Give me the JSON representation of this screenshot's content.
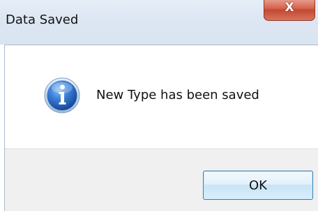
{
  "window": {
    "title": "Data Saved",
    "close_glyph": "X"
  },
  "message": {
    "icon": "information-icon",
    "text": "New Type has been saved"
  },
  "buttons": {
    "ok_label": "OK"
  },
  "colors": {
    "titlebar": "#dde7f3",
    "close_button": "#d7654f",
    "button_area": "#f0f0f0",
    "ok_border": "#3c7fb1",
    "icon_blue": "#1f5fb8"
  }
}
